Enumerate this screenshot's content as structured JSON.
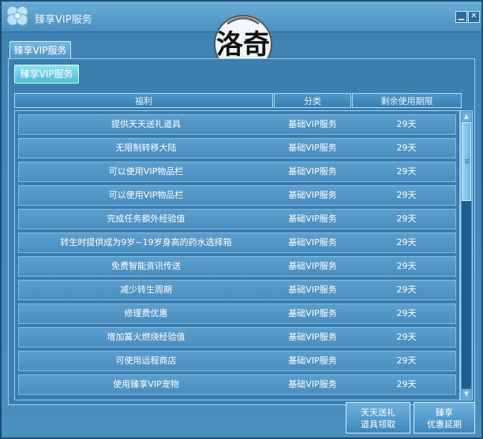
{
  "window": {
    "title": "臻享VIP服务"
  },
  "tabs": [
    {
      "label": "臻享VIP服务"
    }
  ],
  "subtab": {
    "label": "臻享VIP服务"
  },
  "emblem": {
    "text": "洛奇"
  },
  "table": {
    "headers": [
      "福利",
      "分类",
      "剩余使用期限"
    ],
    "rows": [
      {
        "benefit": "提供天天送礼道具",
        "category": "基础VIP服务",
        "period": "29天"
      },
      {
        "benefit": "无限制转移大陆",
        "category": "基础VIP服务",
        "period": "29天"
      },
      {
        "benefit": "可以使用VIP物品栏",
        "category": "基础VIP服务",
        "period": "29天"
      },
      {
        "benefit": "可以使用VIP物品栏",
        "category": "基础VIP服务",
        "period": "29天"
      },
      {
        "benefit": "完成任务额外经验值",
        "category": "基础VIP服务",
        "period": "29天"
      },
      {
        "benefit": "转生时提供成为9岁~19岁身高的药水选择箱",
        "category": "基础VIP服务",
        "period": "29天"
      },
      {
        "benefit": "免费智能资讯传送",
        "category": "基础VIP服务",
        "period": "29天"
      },
      {
        "benefit": "减少转生周期",
        "category": "基础VIP服务",
        "period": "29天"
      },
      {
        "benefit": "修理费优惠",
        "category": "基础VIP服务",
        "period": "29天"
      },
      {
        "benefit": "增加篝火燃烧经验值",
        "category": "基础VIP服务",
        "period": "29天"
      },
      {
        "benefit": "可使用远程商店",
        "category": "基础VIP服务",
        "period": "29天"
      },
      {
        "benefit": "使用臻享VIP宠物",
        "category": "基础VIP服务",
        "period": "29天"
      }
    ]
  },
  "buttons": {
    "daily_gift": [
      "天天送礼",
      "道具领取"
    ],
    "extend": [
      "臻享",
      "优惠延期"
    ]
  },
  "icons": {
    "close": "close-icon",
    "minimize": "minimize-icon",
    "logo": "clover-logo-icon"
  }
}
